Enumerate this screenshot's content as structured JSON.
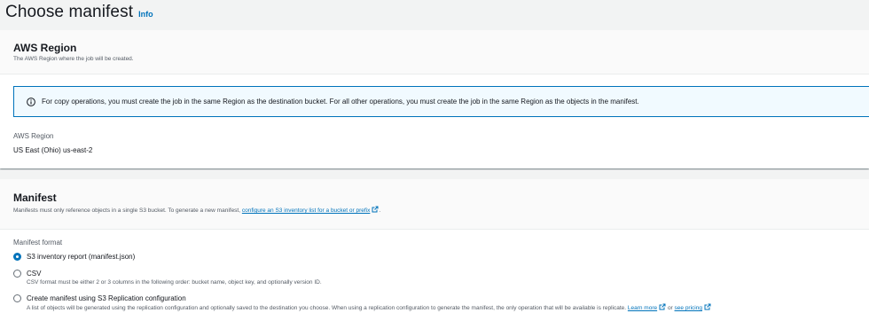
{
  "page": {
    "title": "Choose manifest",
    "info_link": "Info"
  },
  "region_panel": {
    "title": "AWS Region",
    "description": "The AWS Region where the job will be created.",
    "alert_text": "For copy operations, you must create the job in the same Region as the destination bucket. For all other operations, you must create the job in the same Region as the objects in the manifest.",
    "field_label": "AWS Region",
    "field_value": "US East (Ohio) us-east-2"
  },
  "manifest_panel": {
    "title": "Manifest",
    "description_prefix": "Manifests must only reference objects in a single S3 bucket. To generate a new manifest, ",
    "description_link": "configure an S3 inventory list for a bucket or prefix",
    "description_suffix": ".",
    "format_label": "Manifest format",
    "options": [
      {
        "label": "S3 inventory report (manifest.json)",
        "description": "",
        "selected": true
      },
      {
        "label": "CSV",
        "description": "CSV format must be either 2 or 3 columns in the following order: bucket name, object key, and optionally version ID.",
        "selected": false
      },
      {
        "label": "Create manifest using S3 Replication configuration",
        "description": "A list of objects will be generated using the replication configuration and optionally saved to the destination you choose. When using a replication configuration to generate the manifest, the only operation that will be available is replicate.",
        "learn_more": "Learn more",
        "or_text": "or",
        "pricing_link": "see pricing",
        "selected": false
      }
    ]
  },
  "colors": {
    "link": "#0073bb",
    "radio_selected": "#0073bb",
    "alert_border": "#0073bb",
    "alert_bg": "#f1faff"
  },
  "icons": {
    "alert": "info-circle-icon",
    "external": "external-link-icon"
  }
}
